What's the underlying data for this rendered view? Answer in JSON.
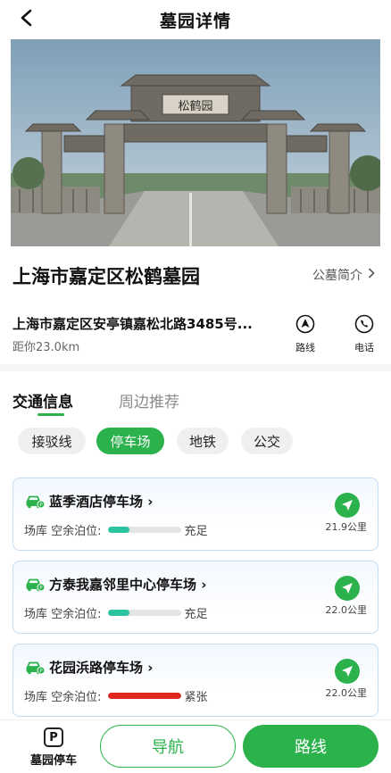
{
  "header": {
    "title": "墓园详情"
  },
  "hero": {
    "sign_text": "松鹤园"
  },
  "cemetery": {
    "name": "上海市嘉定区松鹤墓园",
    "intro_label": "公墓简介",
    "address": "上海市嘉定区安亭镇嘉松北路3485号...",
    "distance": "距你23.0km"
  },
  "actions": {
    "route_label": "路线",
    "phone_label": "电话"
  },
  "tabs": [
    {
      "label": "交通信息",
      "active": true
    },
    {
      "label": "周边推荐",
      "active": false
    }
  ],
  "chips": [
    {
      "label": "接驳线",
      "active": false
    },
    {
      "label": "停车场",
      "active": true
    },
    {
      "label": "地铁",
      "active": false
    },
    {
      "label": "公交",
      "active": false
    }
  ],
  "parking": [
    {
      "name": "蓝季酒店停车场",
      "vacancy_label": "场库 空余泊位:",
      "status": "充足",
      "level": 0.3,
      "bar_color": "#2bc3a0",
      "distance": "21.9公里"
    },
    {
      "name": "方泰我嘉邻里中心停车场",
      "vacancy_label": "场库 空余泊位:",
      "status": "充足",
      "level": 0.3,
      "bar_color": "#2bc3a0",
      "distance": "22.0公里"
    },
    {
      "name": "花园浜路停车场",
      "vacancy_label": "场库 空余泊位:",
      "status": "紧张",
      "level": 1.0,
      "bar_color": "#e0281e",
      "distance": "22.0公里"
    }
  ],
  "bottom": {
    "parking_label": "墓园停车",
    "parking_icon_text": "P",
    "nav_label": "导航",
    "route_label": "路线"
  },
  "colors": {
    "accent": "#2bb24c",
    "card_border": "#c5dcf2",
    "ok": "#2bc3a0",
    "tight": "#e0281e"
  }
}
